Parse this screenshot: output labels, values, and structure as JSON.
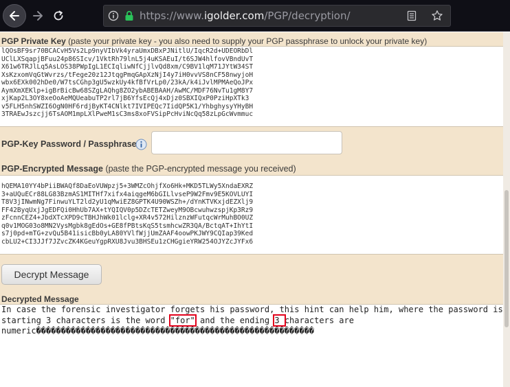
{
  "browser": {
    "url_prefix": "https://www.",
    "url_domain": "igolder.com",
    "url_path": "/PGP/decryption/"
  },
  "private_key": {
    "label_bold": "PGP Private Key",
    "label_note": " (paste your private key - you also need to supply your PGP passphrase to unlock your private key)",
    "lines": [
      "lQOsBF9sr70BCACvH5Vs2Lp9nyVIbVk4yraUmxDBxPJNitlU/IqcR2d+UDEORbDl",
      "UClLXSqapjBFuu24p86SIcv/1VktRh79lnL5j4uKSAEuI/t6SJW4hlfovVBndUvT",
      "X61w6TRJlLq5AsLOS38PWpIgL1ECIqliwNfCjjlvQd8xm/C9BV1lqM71JYtW34ST",
      "XsKzxomVqGtWvrzs/tFege20z12JtqgPmqGApXzNjI4y7iH0vvVS8nCF58nwyjoH",
      "wbx6EXk002hDe0/W7tsCGhp3gU5wzkUy4kfBfVrLp0/23kA/k4iJvlMPMAeQoJPx",
      "AymXmXEKlp+igBrBicBw68SZgLAQhg8ZO2ybABEBAAH/AwMC/MDF76NvTu1gM8Y7",
      "xjKap2L3OY8xeOoAeMQUeabuTP2rl7jB6YfsEcQj4xDjz0SBXIQxP0PziHpXTk3",
      "v5FLH5nhSWZI6OgN0HF6rdjByKT4CNlkt7IVIPEQc7IidQP5K1/YhbghysyYHyBH",
      "3TRAEwJszcjj6TsAOM1mpLXlPweM1sC3ms8xoFVSipPcHviNcQq58zLpGcWvmmuc"
    ]
  },
  "passphrase": {
    "label": "PGP-Key Password / Passphrase:",
    "value": ""
  },
  "encrypted": {
    "label_bold": "PGP-Encrypted Message",
    "label_note": " (paste the PGP-encrypted message you received)",
    "lines": [
      "hQEMA10YY4bPiiBWAQf8DaEoVUWpzj5+3WMZcOhjfXo6Hk+MKD5TLWy5XndaEXRZ",
      "3+aUQuECr88LG83BzmAS1MITHf7xifx4aiqgeM6bGILlvseP9W2Fmv9E5KOVLUYI",
      "T8V3jINwmNg7FinwuYLT2ld2yU1qMwiEZ8GPTK4U90WSZh+/dYnKTVKxjdEZXlj9",
      "FF42ByqUxjJgEDFQi0HhUb7AX+tYQIQV0p5DZcTETZweyM9OBcwuhwzspjKp3Rz9",
      "zFcnnCEZ4+JbdXTcXPD9cTBHJhWk01lclg+XR4v572HilznzWFutqcWrMuhBO0UZ",
      "q0v1MOG03o8MN2VysMgbk8gEdOs+GE8fPBtsKqS5tsmhcwZR3QA/BctqAT+IhYtI",
      "s7j0pd+mTG+zvQu5B41isicBb0yLA80YVlfWjjUmZAAF4oowPKJWY9CQIap39Ked",
      "cbLU2+CI3JJf7JZvcZK4KGeuYgpRXU8Jvu3BHSEu1zCHGgieYRW254OJYZcJYFx6"
    ]
  },
  "decrypt_button": {
    "label": "Decrypt Message"
  },
  "decrypted": {
    "label": "Decrypted Message",
    "line1": "In case the forensic investigator forgets his password, this hint can help him, where the password is of",
    "line2_a": "starting  3 characters is the word ",
    "line2_hl1": "\"for\"",
    "line2_b": " and the ending ",
    "line2_hl2": "3 ",
    "line2_c": "characters are",
    "line3": "numeric��������������������������������������������������������"
  }
}
